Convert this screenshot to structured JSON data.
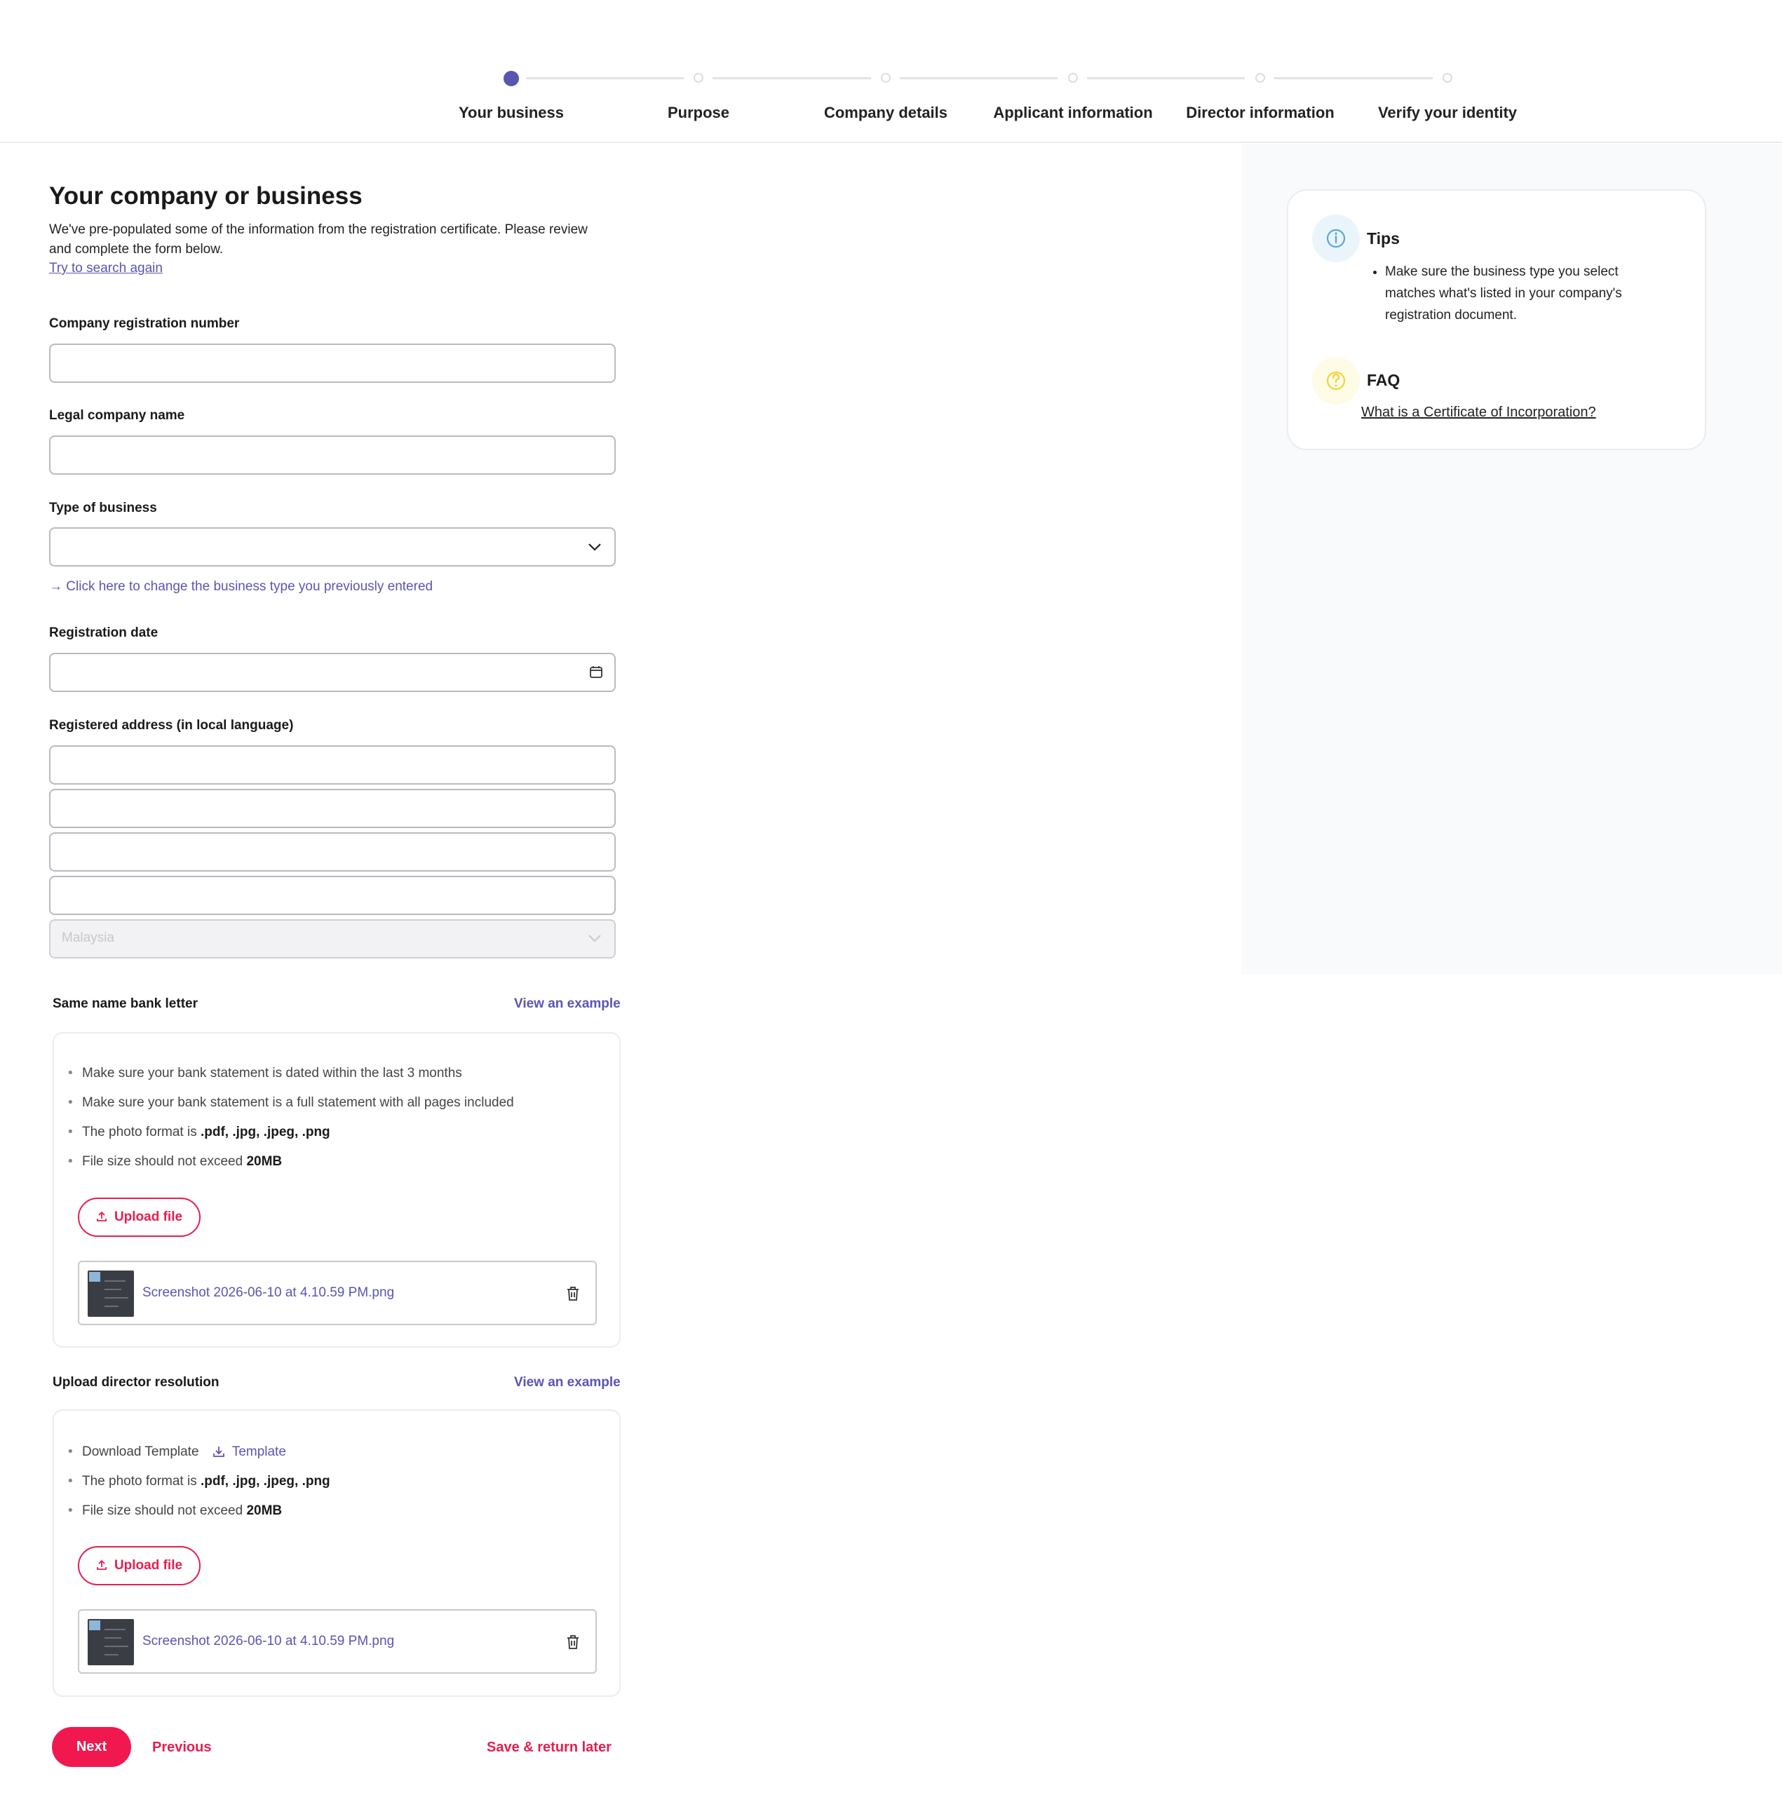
{
  "stepper": {
    "steps": [
      {
        "label": "Your business",
        "active": true
      },
      {
        "label": "Purpose",
        "active": false
      },
      {
        "label": "Company details",
        "active": false
      },
      {
        "label": "Applicant information",
        "active": false
      },
      {
        "label": "Director information",
        "active": false
      },
      {
        "label": "Verify your identity",
        "active": false
      }
    ],
    "accent_color": "#5b55b0"
  },
  "form": {
    "title": "Your company or business",
    "intro": "We've pre-populated some of the information from the registration certificate. Please review and complete the form below.",
    "search_again_link": "Try to search again",
    "company_registration_number": {
      "label": "Company registration number",
      "value": ""
    },
    "legal_company_name": {
      "label": "Legal company name",
      "value": ""
    },
    "type_of_business": {
      "label": "Type of business",
      "value": "",
      "icon": "chevron-down-icon"
    },
    "change_business_type_link": "→  Click here to change the business type you previously entered",
    "registration_date": {
      "label": "Registration date",
      "value": "",
      "icon": "calendar-icon"
    },
    "registered_address": {
      "label": "Registered address (in local language)",
      "lines": [
        "",
        "",
        "",
        ""
      ],
      "country": "Malaysia"
    }
  },
  "bank_letter": {
    "title": "Same name bank letter",
    "example_link": "View an example",
    "bullets": [
      {
        "text": "Make sure your bank statement is dated within the last 3 months",
        "bold": ""
      },
      {
        "text": "Make sure your bank statement is a full statement with all pages included",
        "bold": ""
      },
      {
        "text": "The photo format is ",
        "bold": ".pdf, .jpg, .jpeg, .png"
      },
      {
        "text": "File size should not exceed ",
        "bold": "20MB"
      }
    ],
    "upload_label": "Upload file",
    "file_name": "Screenshot 2026-06-10 at 4.10.59 PM.png"
  },
  "director_resolution": {
    "title": "Upload director resolution",
    "example_link": "View an example",
    "download_text": "Download Template",
    "template_link": "Template",
    "bullets": [
      {
        "text": "The photo format is ",
        "bold": ".pdf, .jpg, .jpeg, .png"
      },
      {
        "text": "File size should not exceed ",
        "bold": "20MB"
      }
    ],
    "upload_label": "Upload file",
    "file_name": "Screenshot 2026-06-10 at 4.10.59 PM.png"
  },
  "tips": {
    "title": "Tips",
    "items": [
      "Make sure the business type you select matches what's listed in your company's registration document."
    ],
    "faq_title": "FAQ",
    "faq_link": "What is a Certificate of Incorporation?"
  },
  "actions": {
    "next": "Next",
    "previous": "Previous",
    "save": "Save & return later",
    "brand_color": "#f0184f"
  }
}
